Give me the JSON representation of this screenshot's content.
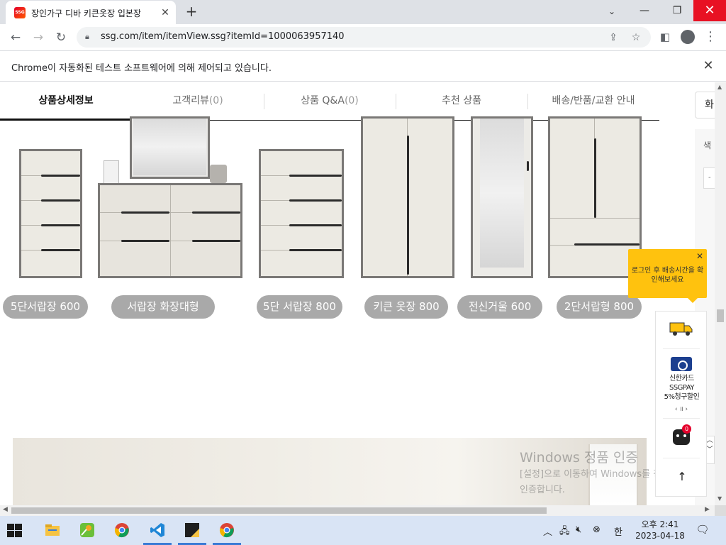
{
  "browser": {
    "tab_title": "장인가구 디바 키큰옷장 입본장",
    "favicon_text": "SSG",
    "url": "ssg.com/item/itemView.ssg?itemId=1000063957140",
    "infobar_text": "Chrome이 자동화된 테스트 소프트웨어에 의해 제어되고 있습니다."
  },
  "product_tabs": [
    {
      "label": "상품상세정보",
      "count": ""
    },
    {
      "label": "고객리뷰",
      "count": "(0)"
    },
    {
      "label": "상품 Q&A",
      "count": "(0)"
    },
    {
      "label": "추천 상품",
      "count": ""
    },
    {
      "label": "배송/반품/교환 안내",
      "count": ""
    }
  ],
  "side_panel": {
    "button_label": "화",
    "color_label": "색"
  },
  "product_labels": [
    "5단서랍장 600",
    "서랍장 화장대형",
    "5단 서랍장 800",
    "키큰 옷장 800",
    "전신거울 600",
    "2단서랍형 800"
  ],
  "tooltip": {
    "text": "로그인 후 배송시간을 확인해보세요"
  },
  "quick_menu": {
    "card_text_1": "신한카드",
    "card_text_2": "SSGPAY",
    "card_text_3": "5%청구할인",
    "pager": "‹  ॥  ›",
    "bot_badge": "0"
  },
  "watermark": {
    "title": "Windows 정품 인증",
    "line1": "[설정]으로 이동하여 Windows를 정품",
    "line2": "인증합니다."
  },
  "taskbar": {
    "clock_time": "오후 2:41",
    "clock_date": "2023-04-18",
    "ime": "한"
  },
  "colors": {
    "accent_yellow": "#ffc20e",
    "label_gray": "#a9a9a9",
    "close_red": "#e81123"
  }
}
